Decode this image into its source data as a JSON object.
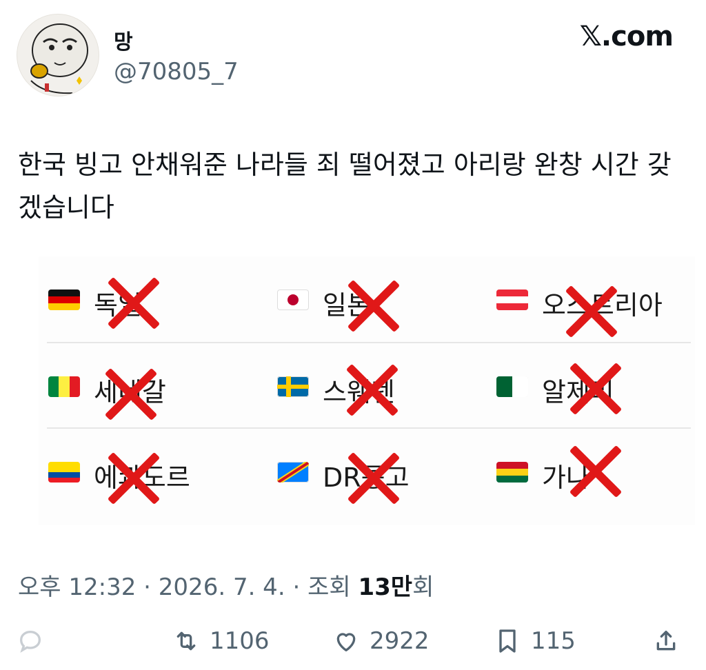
{
  "header": {
    "display_name": "망",
    "handle": "@70805_7",
    "brand": "𝕏.com"
  },
  "tweet": {
    "text": "한국 빙고 안채워준 나라들 죄 떨어졌고 아리랑 완창 시간 갖겠습니다"
  },
  "bingo": {
    "rows": [
      [
        {
          "flag": "germany-flag",
          "name": "독일"
        },
        {
          "flag": "japan-flag",
          "name": "일본"
        },
        {
          "flag": "austria-flag",
          "name": "오스트리아"
        }
      ],
      [
        {
          "flag": "senegal-flag",
          "name": "세네갈"
        },
        {
          "flag": "sweden-flag",
          "name": "스웨덴"
        },
        {
          "flag": "algeria-flag",
          "name": "알제리"
        }
      ],
      [
        {
          "flag": "ecuador-flag",
          "name": "에콰도르"
        },
        {
          "flag": "dr-congo-flag",
          "name": "DR콩고"
        },
        {
          "flag": "ghana-flag",
          "name": "가나"
        }
      ]
    ],
    "all_crossed_out": true,
    "cross_color": "#e01818"
  },
  "meta": {
    "time": "오후 12:32",
    "separator": " · ",
    "date": "2026. 7. 4.",
    "views_prefix": "조회 ",
    "views_number": "13만",
    "views_suffix": "회"
  },
  "actions": {
    "reply_icon": "reply-icon",
    "retweet_icon": "retweet-icon",
    "retweet_count": "1106",
    "like_icon": "heart-icon",
    "like_count": "2922",
    "bookmark_icon": "bookmark-icon",
    "bookmark_count": "115",
    "share_icon": "share-icon"
  },
  "colors": {
    "text": "#0f1419",
    "secondary": "#536471"
  }
}
